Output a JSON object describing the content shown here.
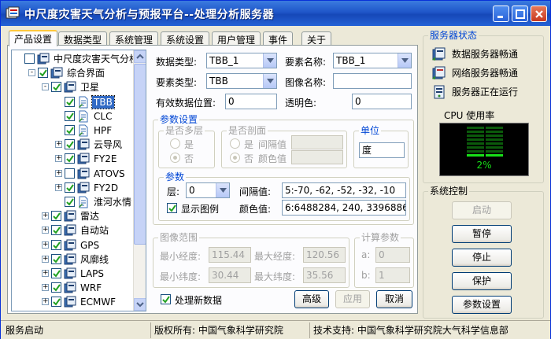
{
  "window": {
    "title": "中尺度灾害天气分析与预报平台--处理分析服务器"
  },
  "tabs": [
    {
      "label": "产品设置",
      "active": true
    },
    {
      "label": "数据类型"
    },
    {
      "label": "系统管理"
    },
    {
      "label": "系统设置"
    },
    {
      "label": "用户管理"
    },
    {
      "label": "事件"
    },
    {
      "label": "关于"
    }
  ],
  "tree": {
    "nodes": [
      {
        "label": "中尺度灾害天气分析",
        "level": 0,
        "expander": "",
        "checked": false,
        "icon": "book-icon",
        "selected": false
      },
      {
        "label": "综合界面",
        "level": 1,
        "expander": "-",
        "checked": true,
        "icon": "book-icon",
        "selected": false
      },
      {
        "label": "卫星",
        "level": 2,
        "expander": "-",
        "checked": true,
        "icon": "book-icon",
        "selected": false
      },
      {
        "label": "TBB",
        "level": 3,
        "expander": "",
        "checked": true,
        "icon": "page-icon",
        "selected": true
      },
      {
        "label": "CLC",
        "level": 3,
        "expander": "",
        "checked": true,
        "icon": "page-icon",
        "selected": false
      },
      {
        "label": "HPF",
        "level": 3,
        "expander": "",
        "checked": true,
        "icon": "page-icon",
        "selected": false
      },
      {
        "label": "云导风",
        "level": 3,
        "expander": "+",
        "checked": true,
        "icon": "book-icon",
        "selected": false
      },
      {
        "label": "FY2E",
        "level": 3,
        "expander": "+",
        "checked": true,
        "icon": "book-icon",
        "selected": false
      },
      {
        "label": "ATOVS",
        "level": 3,
        "expander": "+",
        "checked": false,
        "icon": "book-icon",
        "selected": false
      },
      {
        "label": "FY2D",
        "level": 3,
        "expander": "+",
        "checked": true,
        "icon": "book-icon",
        "selected": false
      },
      {
        "label": "淮河水情",
        "level": 3,
        "expander": "",
        "checked": true,
        "icon": "page-icon",
        "selected": false
      },
      {
        "label": "雷达",
        "level": 2,
        "expander": "+",
        "checked": true,
        "icon": "book-icon",
        "selected": false
      },
      {
        "label": "自动站",
        "level": 2,
        "expander": "+",
        "checked": true,
        "icon": "book-icon",
        "selected": false
      },
      {
        "label": "GPS",
        "level": 2,
        "expander": "+",
        "checked": true,
        "icon": "book-icon",
        "selected": false
      },
      {
        "label": "风廓线",
        "level": 2,
        "expander": "+",
        "checked": true,
        "icon": "book-icon",
        "selected": false
      },
      {
        "label": "LAPS",
        "level": 2,
        "expander": "+",
        "checked": true,
        "icon": "book-icon",
        "selected": false
      },
      {
        "label": "WRF",
        "level": 2,
        "expander": "+",
        "checked": true,
        "icon": "book-icon",
        "selected": false
      },
      {
        "label": "ECMWF",
        "level": 2,
        "expander": "+",
        "checked": true,
        "icon": "book-icon",
        "selected": false
      }
    ]
  },
  "form": {
    "data_type_label": "数据类型:",
    "data_type_value": "TBB_1",
    "element_name_label": "要素名称:",
    "element_name_value": "TBB_1",
    "element_type_label": "要素类型:",
    "element_type_value": "TBB",
    "image_name_label": "图像名称:",
    "image_name_value": "",
    "valid_pos_label": "有效数据位置:",
    "valid_pos_value": "0",
    "transparent_label": "透明色:",
    "transparent_value": "0"
  },
  "params": {
    "group_title": "参数设置",
    "multilayer": {
      "title": "是否多层",
      "yes": "是",
      "no": "否",
      "selected": "no"
    },
    "profile": {
      "title": "是否剖面",
      "yes": "是",
      "no": "否",
      "interval_label": "间隔值",
      "color_label": "颜色值",
      "interval_value": "",
      "color_value": "",
      "selected": "no"
    },
    "unit": {
      "title": "单位",
      "value": "度"
    },
    "sub": {
      "title": "参数",
      "layer_label": "层:",
      "layer_value": "0",
      "interval_label": "间隔值:",
      "interval_value": "5:-70, -62, -52, -32, -10",
      "color_label": "颜色值:",
      "color_value": "6:6488284, 240, 3396886, 16",
      "show_legend_label": "显示图例",
      "show_legend_checked": true
    }
  },
  "image_range": {
    "title": "图像范围",
    "min_lon_label": "最小经度:",
    "min_lon_value": "115.44",
    "max_lon_label": "最大经度:",
    "max_lon_value": "120.56",
    "min_lat_label": "最小纬度:",
    "min_lat_value": "30.44",
    "max_lat_label": "最大纬度:",
    "max_lat_value": "35.56"
  },
  "calc": {
    "title": "计算参数",
    "a_label": "a:",
    "a_value": "0",
    "b_label": "b:",
    "b_value": "1"
  },
  "bottom": {
    "process_new_label": "处理新数据",
    "process_new_checked": true,
    "advanced": "高级",
    "apply": "应用",
    "cancel": "取消"
  },
  "server_status": {
    "title": "服务器状态",
    "items": [
      "数据服务器畅通",
      "网络服务器畅通",
      "服务器正在运行"
    ],
    "cpu_title": "CPU 使用率",
    "cpu_value": "2%",
    "cpu_level": 0.02
  },
  "system_control": {
    "title": "系统控制",
    "start": "启动",
    "pause": "暂停",
    "stop": "停止",
    "protect": "保护",
    "param_settings": "参数设置"
  },
  "statusbar": {
    "status": "服务启动",
    "copyright": "版权所有: 中国气象科学研究院",
    "support": "技术支持: 中国气象科学研究院大气科学信息部"
  },
  "colors": {
    "title_bar": "#1f56c9",
    "tree_selection": "#316ac5",
    "cpu_green": "#18e018",
    "group_title": "#0046d5"
  }
}
